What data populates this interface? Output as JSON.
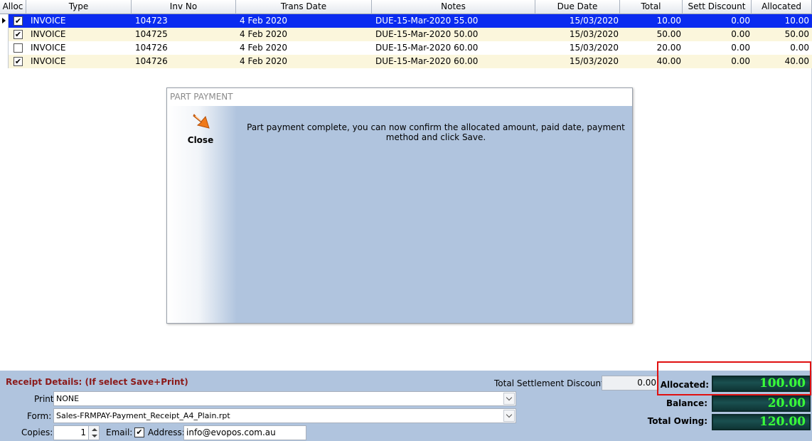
{
  "grid": {
    "columns": [
      "Alloc",
      "Type",
      "Inv No",
      "Trans Date",
      "Notes",
      "Due Date",
      "Total",
      "Sett Discount",
      "Allocated"
    ],
    "rows": [
      {
        "alloc": "✔",
        "type": "INVOICE",
        "inv_no": "104723",
        "trans_date": "4 Feb 2020",
        "notes": "DUE-15-Mar-2020 55.00",
        "due_date": "15/03/2020",
        "total": "10.00",
        "sett_discount": "0.00",
        "allocated": "10.00",
        "selected": true
      },
      {
        "alloc": "✔",
        "type": "INVOICE",
        "inv_no": "104725",
        "trans_date": "4 Feb 2020",
        "notes": "DUE-15-Mar-2020 50.00",
        "due_date": "15/03/2020",
        "total": "50.00",
        "sett_discount": "0.00",
        "allocated": "50.00",
        "selected": false
      },
      {
        "alloc": "",
        "type": "INVOICE",
        "inv_no": "104726",
        "trans_date": "4 Feb 2020",
        "notes": "DUE-15-Mar-2020 60.00",
        "due_date": "15/03/2020",
        "total": "20.00",
        "sett_discount": "0.00",
        "allocated": "0.00",
        "selected": false
      },
      {
        "alloc": "✔",
        "type": "INVOICE",
        "inv_no": "104726",
        "trans_date": "4 Feb 2020",
        "notes": "DUE-15-Mar-2020 60.00",
        "due_date": "15/03/2020",
        "total": "40.00",
        "sett_discount": "0.00",
        "allocated": "40.00",
        "selected": false
      }
    ],
    "selected_row_color": "#0a2bf0",
    "alt_row_color": "#fbf6dc"
  },
  "dialog": {
    "title": "PART PAYMENT",
    "close_label": "Close",
    "close_icon": "orange-arrow-icon",
    "message": "Part payment complete, you can now confirm the allocated amount, paid date, payment method and click Save."
  },
  "receipt": {
    "title": "Receipt Details: (If select Save+Print)",
    "printer_label": "Printer:",
    "printer_value": "NONE",
    "form_label": "Form:",
    "form_value": "Sales-FRMPAY-Payment_Receipt_A4_Plain.rpt",
    "copies_label": "Copies:",
    "copies_value": "1",
    "email_label": "Email:",
    "email_checked": "✔",
    "address_label": "Address:",
    "address_value": "info@evopos.com.au"
  },
  "totals": {
    "settlement_label": "Total Settlement Discount:",
    "settlement_value": "0.00",
    "allocated_label": "Allocated:",
    "allocated_value": "100.00",
    "balance_label": "Balance:",
    "balance_value": "20.00",
    "owing_label": "Total Owing:",
    "owing_value": "120.00",
    "lcd_color": "#39ff39",
    "highlight_color": "#e01010"
  }
}
